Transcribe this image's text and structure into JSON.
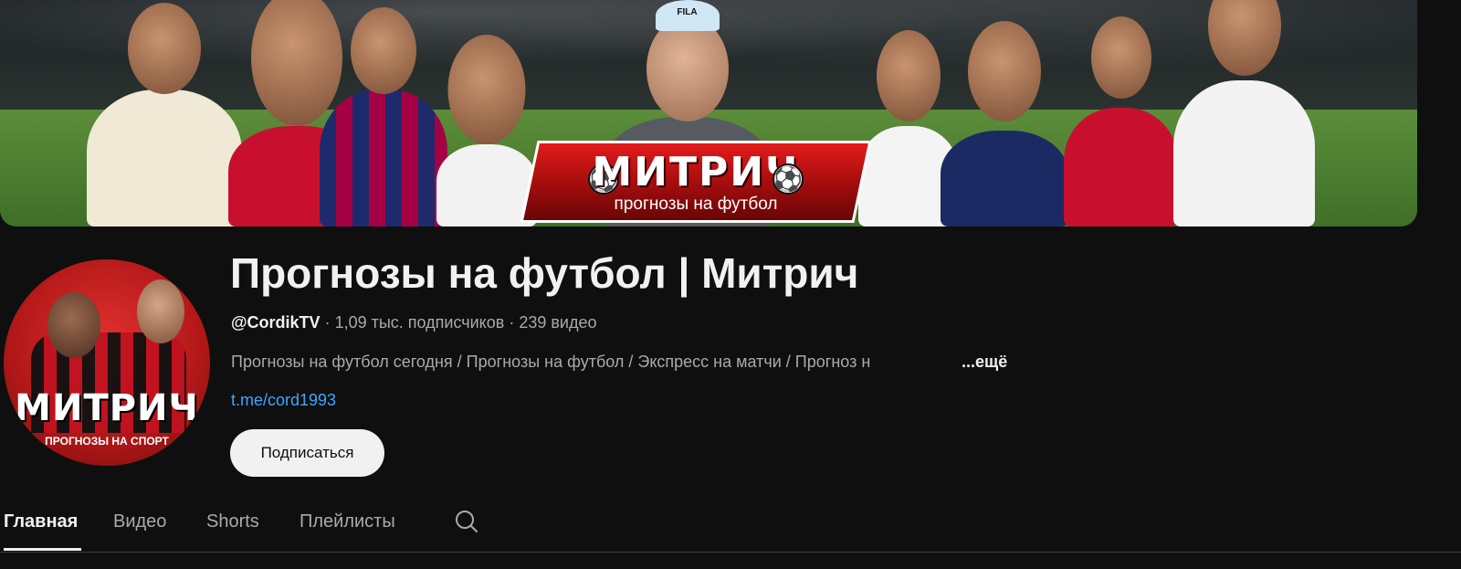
{
  "banner": {
    "logo_title": "МИТРИЧ",
    "logo_subtitle": "прогнозы на футбол",
    "cap_text": "FILA"
  },
  "avatar": {
    "title": "МИТРИЧ",
    "subtitle": "ПРОГНОЗЫ НА СПОРТ"
  },
  "channel": {
    "name": "Прогнозы на футбол | Митрич",
    "handle": "@CordikTV",
    "separator": "·",
    "subscribers": "1,09 тыс. подписчиков",
    "videos": "239 видео",
    "description": "Прогнозы на футбол сегодня / Прогнозы на футбол / Экспресс на матчи / Прогноз н",
    "more_label": "...ещё",
    "link": "t.me/cord1993",
    "subscribe_label": "Подписаться"
  },
  "tabs": [
    {
      "label": "Главная",
      "active": true
    },
    {
      "label": "Видео",
      "active": false
    },
    {
      "label": "Shorts",
      "active": false
    },
    {
      "label": "Плейлисты",
      "active": false
    }
  ],
  "icons": {
    "search": "search-icon"
  },
  "colors": {
    "background": "#0f0f0f",
    "link": "#3ea6ff",
    "logo_red": "#c1121f"
  }
}
